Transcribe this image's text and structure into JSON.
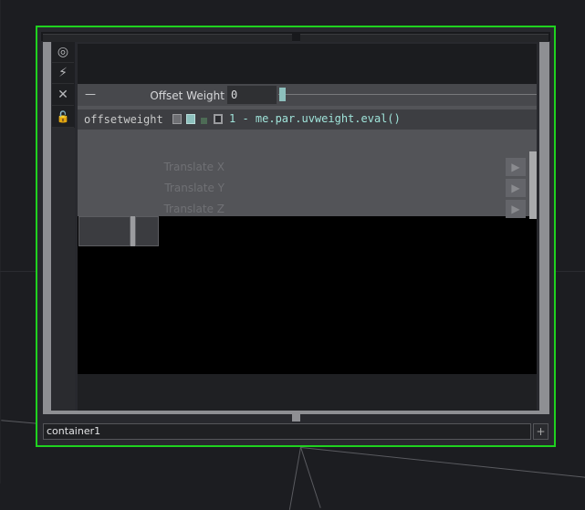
{
  "node": {
    "name": "container1"
  },
  "toolbar": {
    "icons": [
      "viewer-active-icon",
      "cook-flag-icon",
      "bypass-icon",
      "lock-icon"
    ],
    "glyphs": [
      "◎",
      "⚡",
      "✕",
      "🔓"
    ]
  },
  "params": {
    "collapse_glyph": "—",
    "offset_weight_label": "Offset Weight",
    "offset_weight_value": "0",
    "offset_weight_slider": 0.0,
    "par_name": "offsetweight",
    "expression": "1 - me.par.uvweight.eval()",
    "translate": [
      "Translate X",
      "Translate Y",
      "Translate Z"
    ],
    "play_glyph": "▶"
  },
  "add_glyph": "+",
  "colors": {
    "selection": "#1fd21f",
    "expression": "#9fe3d9",
    "slider_handle": "#8dc0bd"
  }
}
